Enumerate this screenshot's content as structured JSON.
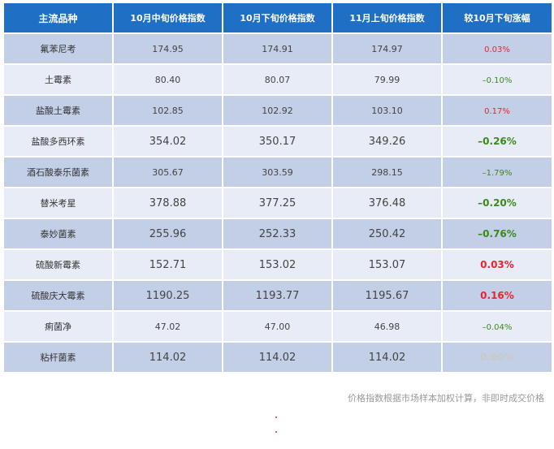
{
  "table": {
    "headers": [
      "主流品种",
      "10月中旬价格指数",
      "10月下旬价格指数",
      "11月上旬价格指数",
      "较10月下旬涨幅"
    ],
    "rows": [
      {
        "name": "氟苯尼考",
        "mid_oct": "174.95",
        "late_oct": "174.91",
        "early_nov": "174.97",
        "change": "0.03%",
        "trend": "up",
        "size": "small"
      },
      {
        "name": "土霉素",
        "mid_oct": "80.40",
        "late_oct": "80.07",
        "early_nov": "79.99",
        "change": "–0.10%",
        "trend": "down",
        "size": "small"
      },
      {
        "name": "盐酸土霉素",
        "mid_oct": "102.85",
        "late_oct": "102.92",
        "early_nov": "103.10",
        "change": "0.17%",
        "trend": "up",
        "size": "small"
      },
      {
        "name": "盐酸多西环素",
        "mid_oct": "354.02",
        "late_oct": "350.17",
        "early_nov": "349.26",
        "change": "–0.26%",
        "trend": "down",
        "size": "big"
      },
      {
        "name": "酒石酸泰乐菌素",
        "mid_oct": "305.67",
        "late_oct": "303.59",
        "early_nov": "298.15",
        "change": "–1.79%",
        "trend": "down",
        "size": "small"
      },
      {
        "name": "替米考星",
        "mid_oct": "378.88",
        "late_oct": "377.25",
        "early_nov": "376.48",
        "change": "–0.20%",
        "trend": "down",
        "size": "big"
      },
      {
        "name": "泰妙菌素",
        "mid_oct": "255.96",
        "late_oct": "252.33",
        "early_nov": "250.42",
        "change": "–0.76%",
        "trend": "down",
        "size": "big"
      },
      {
        "name": "硫酸新霉素",
        "mid_oct": "152.71",
        "late_oct": "153.02",
        "early_nov": "153.07",
        "change": "0.03%",
        "trend": "up",
        "size": "big"
      },
      {
        "name": "硫酸庆大霉素",
        "mid_oct": "1190.25",
        "late_oct": "1193.77",
        "early_nov": "1195.67",
        "change": "0.16%",
        "trend": "up",
        "size": "big"
      },
      {
        "name": "痢菌净",
        "mid_oct": "47.02",
        "late_oct": "47.00",
        "early_nov": "46.98",
        "change": "–0.04%",
        "trend": "down",
        "size": "small"
      },
      {
        "name": "粘杆菌素",
        "mid_oct": "114.02",
        "late_oct": "114.02",
        "early_nov": "114.02",
        "change": "0.00%",
        "trend": "flat",
        "size": "big"
      }
    ]
  },
  "footnote": "价格指数根据市场样本加权计算，非即时成交价格",
  "colors": {
    "header": "#1f6fc5",
    "row_odd": "#c3cee7",
    "row_even": "#e8ecf6",
    "up": "#e8242f",
    "down": "#3a8a1a",
    "flat": "#c9c9c9"
  }
}
